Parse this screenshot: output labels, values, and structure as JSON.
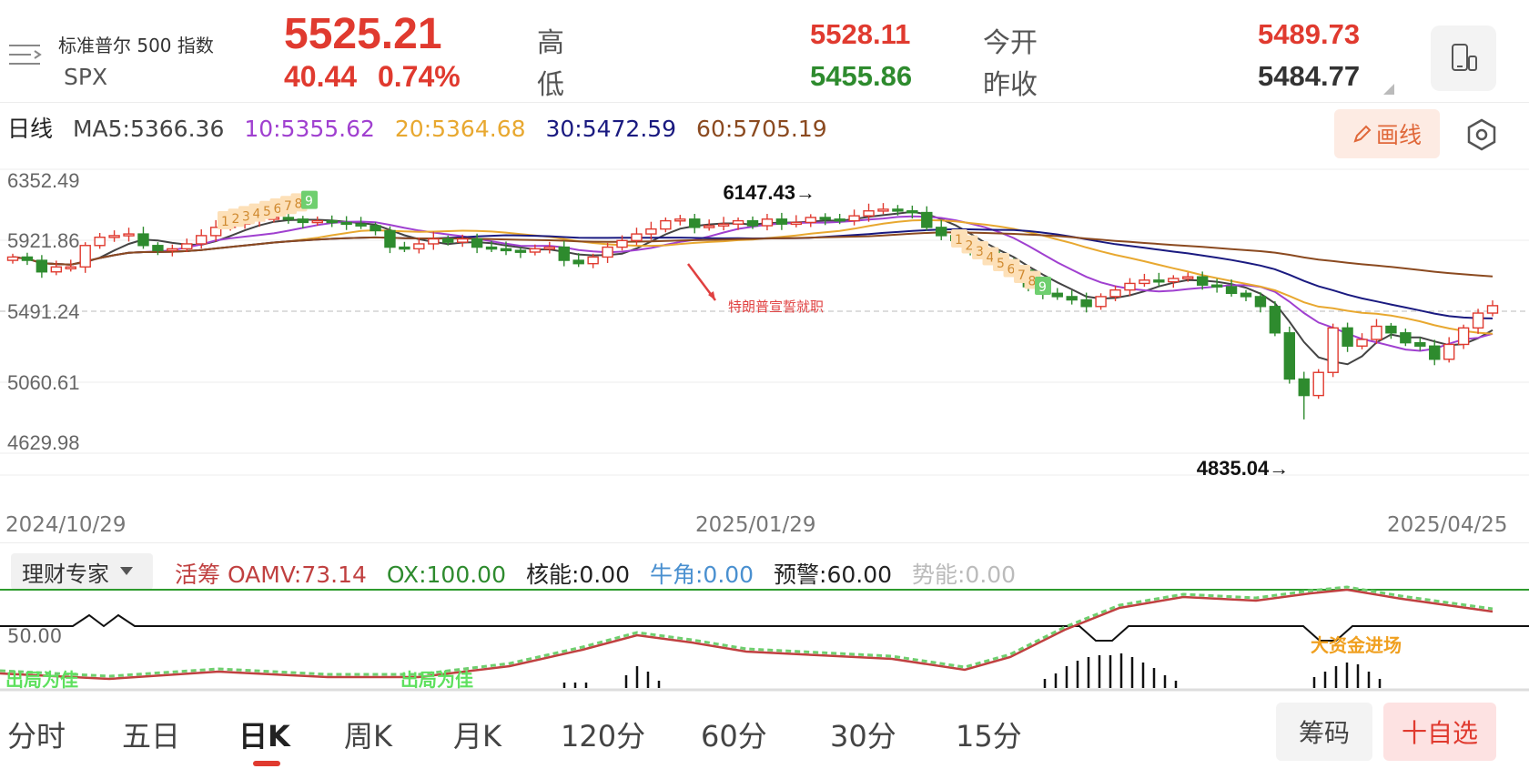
{
  "header": {
    "index_name": "标准普尔 500 指数",
    "index_code": "SPX",
    "price": "5525.21",
    "change": "40.44",
    "change_pct": "0.74%",
    "high_label": "高",
    "high_value": "5528.11",
    "low_label": "低",
    "low_value": "5455.86",
    "open_label": "今开",
    "open_value": "5489.73",
    "prev_close_label": "昨收",
    "prev_close_value": "5484.77"
  },
  "ma_row": {
    "period_label": "日线",
    "ma5": "MA5:5366.36",
    "ma10": "10:5355.62",
    "ma20": "20:5364.68",
    "ma30": "30:5472.59",
    "ma60": "60:5705.19"
  },
  "toolbar": {
    "draw_label": "画线"
  },
  "colors": {
    "up": "#e03a2f",
    "down": "#2e8b2e",
    "ma5": "#444444",
    "ma10": "#a040d0",
    "ma20": "#e8a830",
    "ma30": "#1a1a80",
    "ma60": "#8b4a20"
  },
  "chart": {
    "y_labels": [
      "6352.49",
      "5921.86",
      "5491.24",
      "5060.61",
      "4629.98"
    ],
    "y_values": [
      6352.49,
      5921.86,
      5491.24,
      5060.61,
      4629.98
    ],
    "x_labels": [
      "2024/10/29",
      "2025/01/29",
      "2025/04/25"
    ],
    "high_annotation": "6147.43→",
    "low_annotation": "4835.04→",
    "event_annotation": "特朗普宣誓就职",
    "td_count_labels": [
      "1",
      "2",
      "3",
      "4",
      "5",
      "6",
      "7",
      "8",
      "9"
    ]
  },
  "chart_data": {
    "type": "candlestick",
    "ylim": [
      4629.98,
      6352.49
    ],
    "x_start": "2024/10/29",
    "x_mid": "2025/01/29",
    "x_end": "2025/04/25",
    "annotated_high": 6147.43,
    "annotated_low": 4835.04,
    "last_close": 5525.21,
    "close_path": [
      5820,
      5800,
      5730,
      5760,
      5760,
      5890,
      5940,
      5950,
      5960,
      5890,
      5860,
      5870,
      5900,
      5950,
      6000,
      6020,
      6040,
      6050,
      6060,
      6050,
      6030,
      6040,
      6030,
      6020,
      6010,
      5980,
      5880,
      5870,
      5900,
      5930,
      5910,
      5930,
      5880,
      5870,
      5860,
      5850,
      5870,
      5880,
      5800,
      5780,
      5820,
      5880,
      5920,
      5960,
      5990,
      6040,
      6050,
      6000,
      6010,
      6020,
      6040,
      6010,
      6050,
      6020,
      6030,
      6060,
      6050,
      6040,
      6070,
      6100,
      6110,
      6100,
      6090,
      6000,
      5950,
      5920,
      5850,
      5820,
      5770,
      5740,
      5640,
      5600,
      5580,
      5560,
      5520,
      5580,
      5620,
      5660,
      5680,
      5670,
      5690,
      5700,
      5650,
      5640,
      5600,
      5580,
      5520,
      5360,
      5080,
      4980,
      5120,
      5390,
      5280,
      5320,
      5400,
      5360,
      5300,
      5280,
      5200,
      5290,
      5390,
      5480,
      5525
    ]
  },
  "indicator": {
    "selector_label": "理财专家",
    "oamv": "活筹 OAMV:73.14",
    "ox": "OX:100.00",
    "core_energy": "核能:0.00",
    "bull_angle": "牛角:0.00",
    "warning": "预警:60.00",
    "potential": "势能:0.00",
    "level_label": "50.00",
    "signal_out_1": "出局为佳",
    "signal_out_2": "出局为佳",
    "signal_in": "大资金进场"
  },
  "tabs": [
    "分时",
    "五日",
    "日K",
    "周K",
    "月K",
    "120分",
    "60分",
    "30分",
    "15分"
  ],
  "buttons": {
    "chips": "筹码",
    "add_favorite": "十自选"
  },
  "icons": {
    "menu": "menu-lines-icon",
    "phone": "phone-rotate-icon",
    "settings": "hexagon-settings-icon",
    "pencil": "pencil-icon",
    "dropdown": "triangle-down-icon"
  }
}
